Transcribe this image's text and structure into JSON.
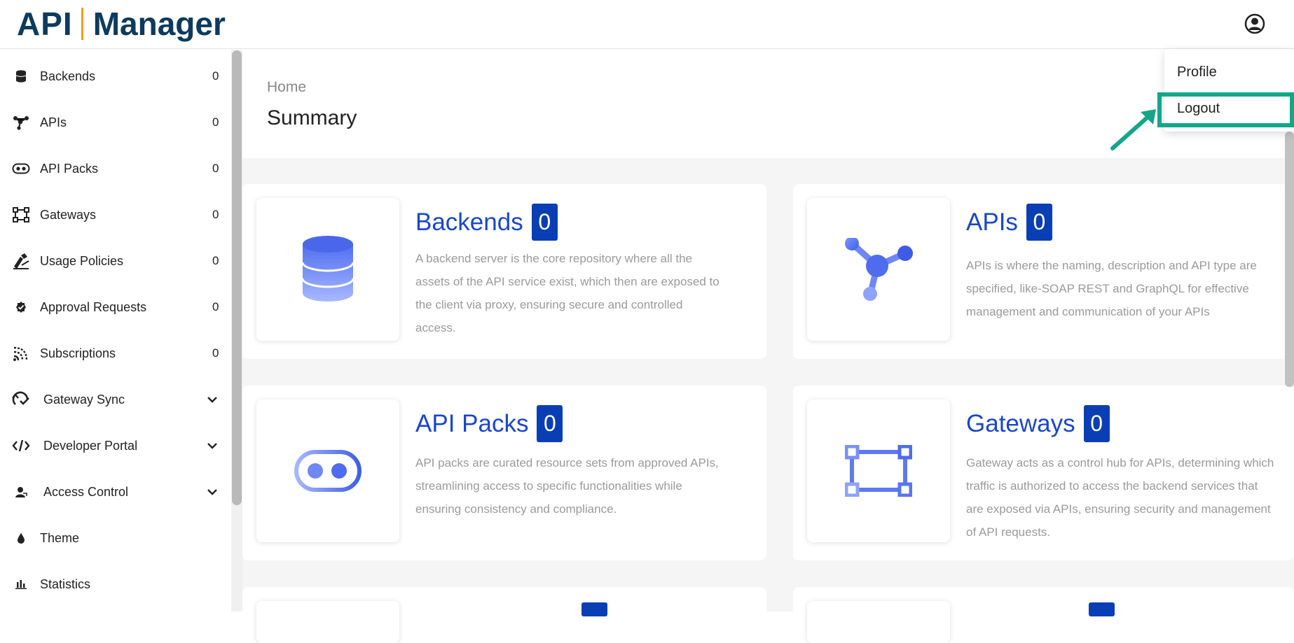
{
  "header": {
    "logo_api": "API",
    "logo_manager": "Manager"
  },
  "sidebar": {
    "items": [
      {
        "label": "Backends",
        "count": "0",
        "icon": "database-icon"
      },
      {
        "label": "APIs",
        "count": "0",
        "icon": "api-icon"
      },
      {
        "label": "API Packs",
        "count": "0",
        "icon": "pack-icon"
      },
      {
        "label": "Gateways",
        "count": "0",
        "icon": "gateway-icon"
      },
      {
        "label": "Usage Policies",
        "count": "0",
        "icon": "policy-icon"
      },
      {
        "label": "Approval Requests",
        "count": "0",
        "icon": "approval-icon"
      },
      {
        "label": "Subscriptions",
        "count": "0",
        "icon": "subscriptions-icon"
      },
      {
        "label": "Gateway Sync",
        "icon": "sync-icon"
      },
      {
        "label": "Developer Portal",
        "icon": "code-icon"
      },
      {
        "label": "Access Control",
        "icon": "user-icon"
      },
      {
        "label": "Theme",
        "icon": "drop-icon"
      },
      {
        "label": "Statistics",
        "icon": "bar-chart-icon"
      }
    ]
  },
  "main": {
    "breadcrumb": "Home",
    "title": "Summary",
    "cards": [
      {
        "title": "Backends",
        "count": "0",
        "desc": "A backend server is the core repository where all the assets of the API service exist, which then are exposed to the client via proxy, ensuring secure and controlled access."
      },
      {
        "title": "APIs",
        "count": "0",
        "desc": "APIs is where the naming, description and API type are specified, like-SOAP REST and GraphQL for effective management and communication of your APIs"
      },
      {
        "title": "API Packs",
        "count": "0",
        "desc": "API packs are curated resource sets from approved APIs, streamlining access to specific functionalities while ensuring consistency and compliance."
      },
      {
        "title": "Gateways",
        "count": "0",
        "desc": "Gateway acts as a control hub for APIs, determining which traffic is authorized to access the backend services that are exposed via APIs, ensuring security and management of API requests."
      }
    ]
  },
  "user_menu": {
    "profile": "Profile",
    "logout": "Logout"
  },
  "colors": {
    "accent": "#1a47c7",
    "badge": "#0a3eb5",
    "highlight": "#13a689",
    "logo_dark": "#0d3a5e",
    "logo_orange": "#f39c12"
  }
}
